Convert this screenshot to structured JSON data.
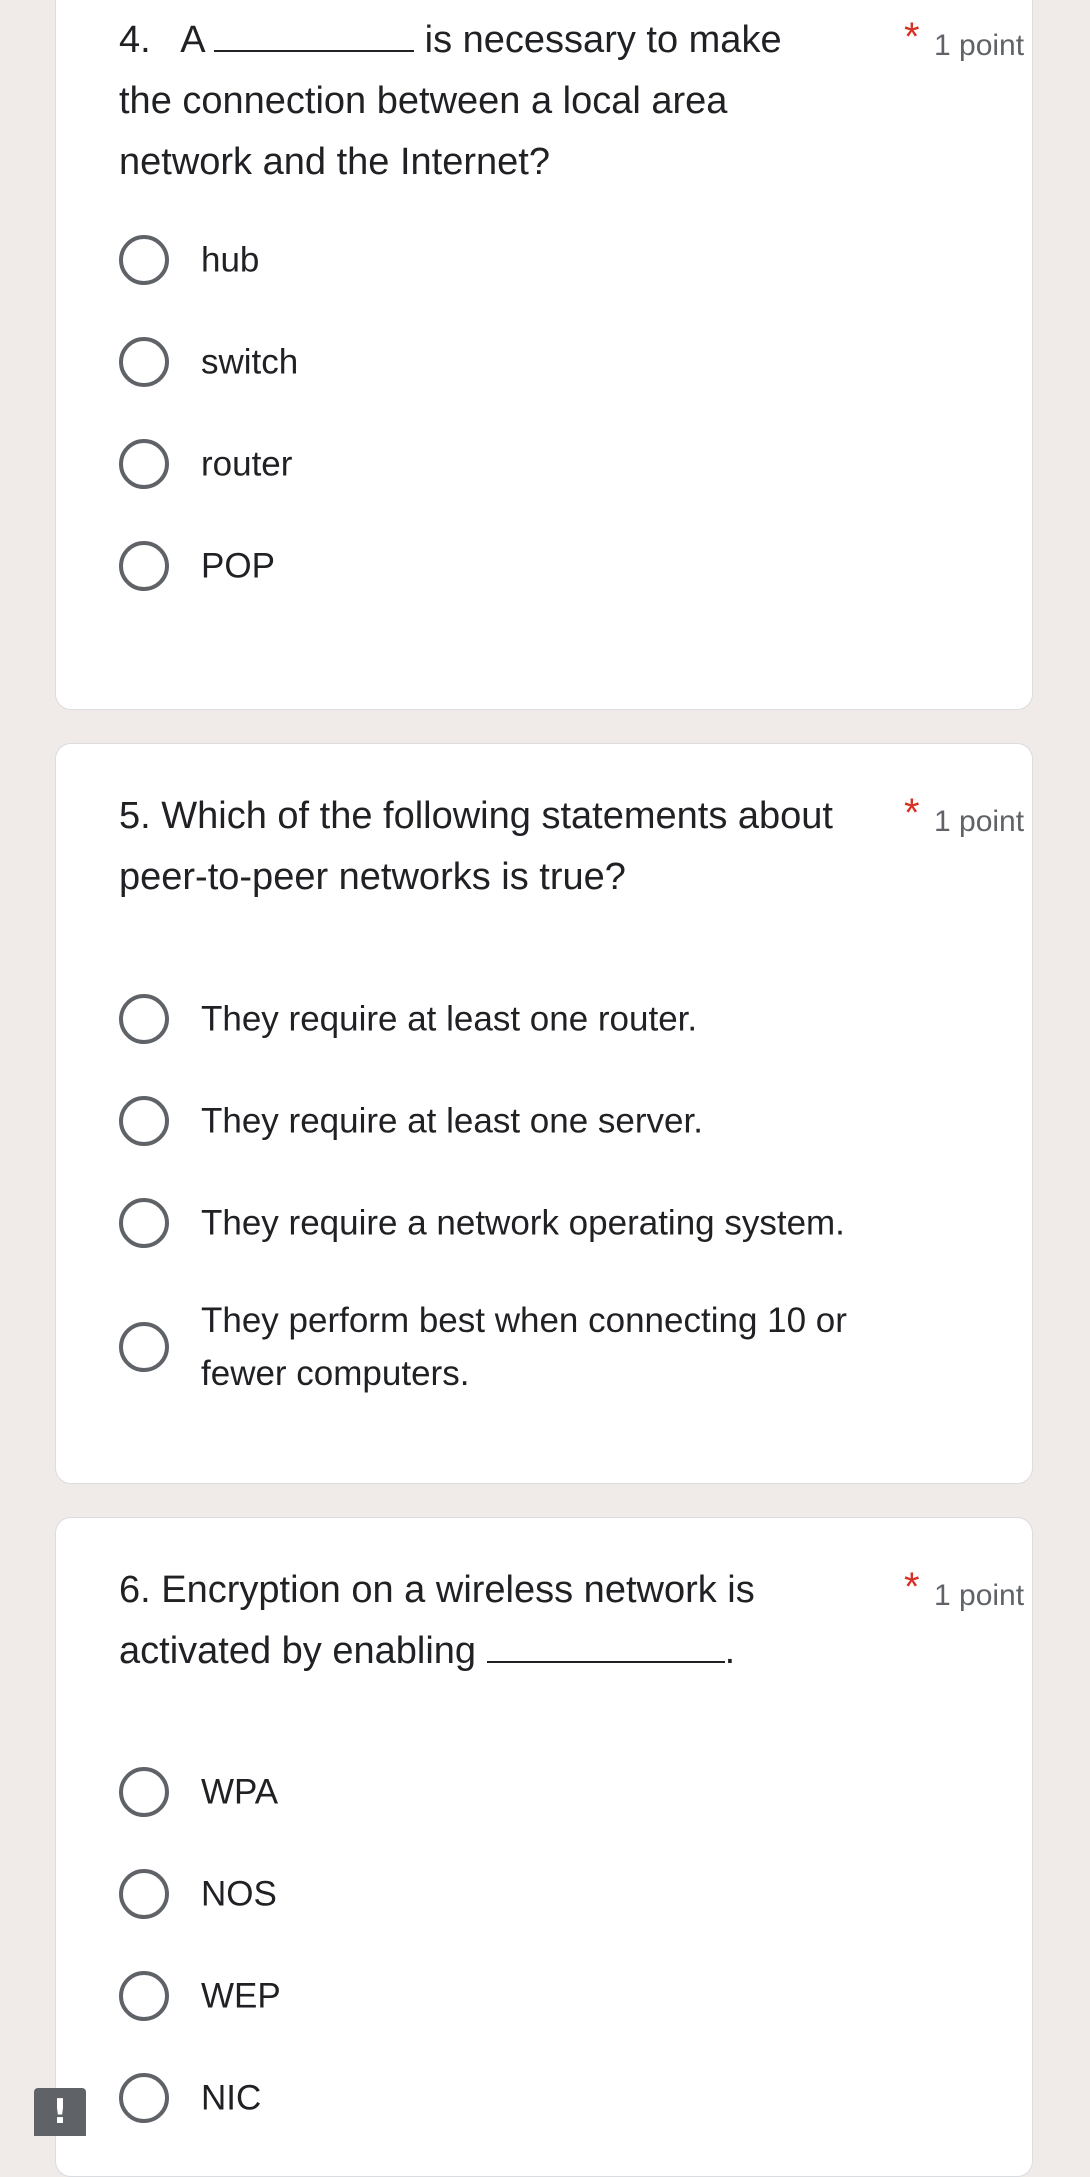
{
  "questions": [
    {
      "number": "4.",
      "text_before": "A",
      "text_after": "is necessary to make the connection between a local area network and the Internet?",
      "required_mark": "*",
      "points": "1 point",
      "options": [
        "hub",
        "switch",
        "router",
        "POP"
      ]
    },
    {
      "number": "5.",
      "text": "Which of the following statements about peer-to-peer networks is true?",
      "required_mark": "*",
      "points": "1 point",
      "options": [
        "They require at least one router.",
        "They require at least one server.",
        "They require a network operating system.",
        "They perform best when connecting 10 or fewer computers."
      ]
    },
    {
      "number": "6.",
      "text_before": "Encryption on a wireless network is activated by enabling",
      "text_after": ".",
      "required_mark": "*",
      "points": "1 point",
      "options": [
        "WPA",
        "NOS",
        "WEP",
        "NIC"
      ]
    }
  ],
  "report_badge": "!",
  "colors": {
    "page_background": "#f0ebe8",
    "card_background": "#ffffff",
    "required": "#d93025",
    "radio_border": "#5f6368",
    "points_text": "#5f6368"
  }
}
